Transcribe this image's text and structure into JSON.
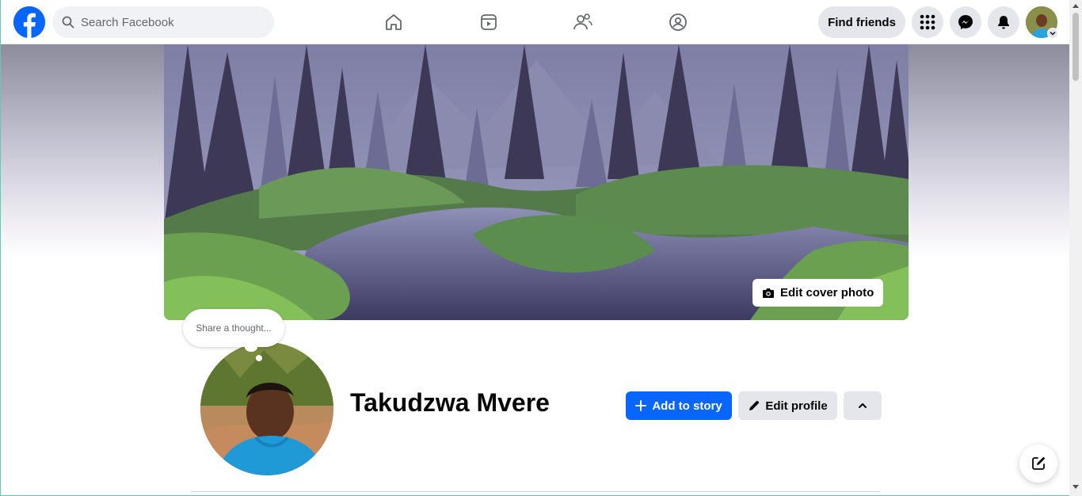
{
  "topbar": {
    "search": {
      "placeholder": "Search Facebook"
    },
    "nav_tabs": [
      "home-icon",
      "video-icon",
      "friends-icon",
      "gaming-icon"
    ],
    "find_friends_label": "Find friends",
    "menu_icon": "grid-menu-icon",
    "messenger_icon": "messenger-icon",
    "notifications_icon": "bell-icon"
  },
  "cover": {
    "edit_label": "Edit cover photo"
  },
  "thought_bubble": {
    "text": "Share a thought..."
  },
  "profile": {
    "name": "Takudzwa Mvere"
  },
  "actions": {
    "add_story_label": "Add to story",
    "edit_profile_label": "Edit profile"
  },
  "colors": {
    "brand": "#0866ff",
    "button_gray": "#e4e6eb",
    "text": "#050505"
  }
}
